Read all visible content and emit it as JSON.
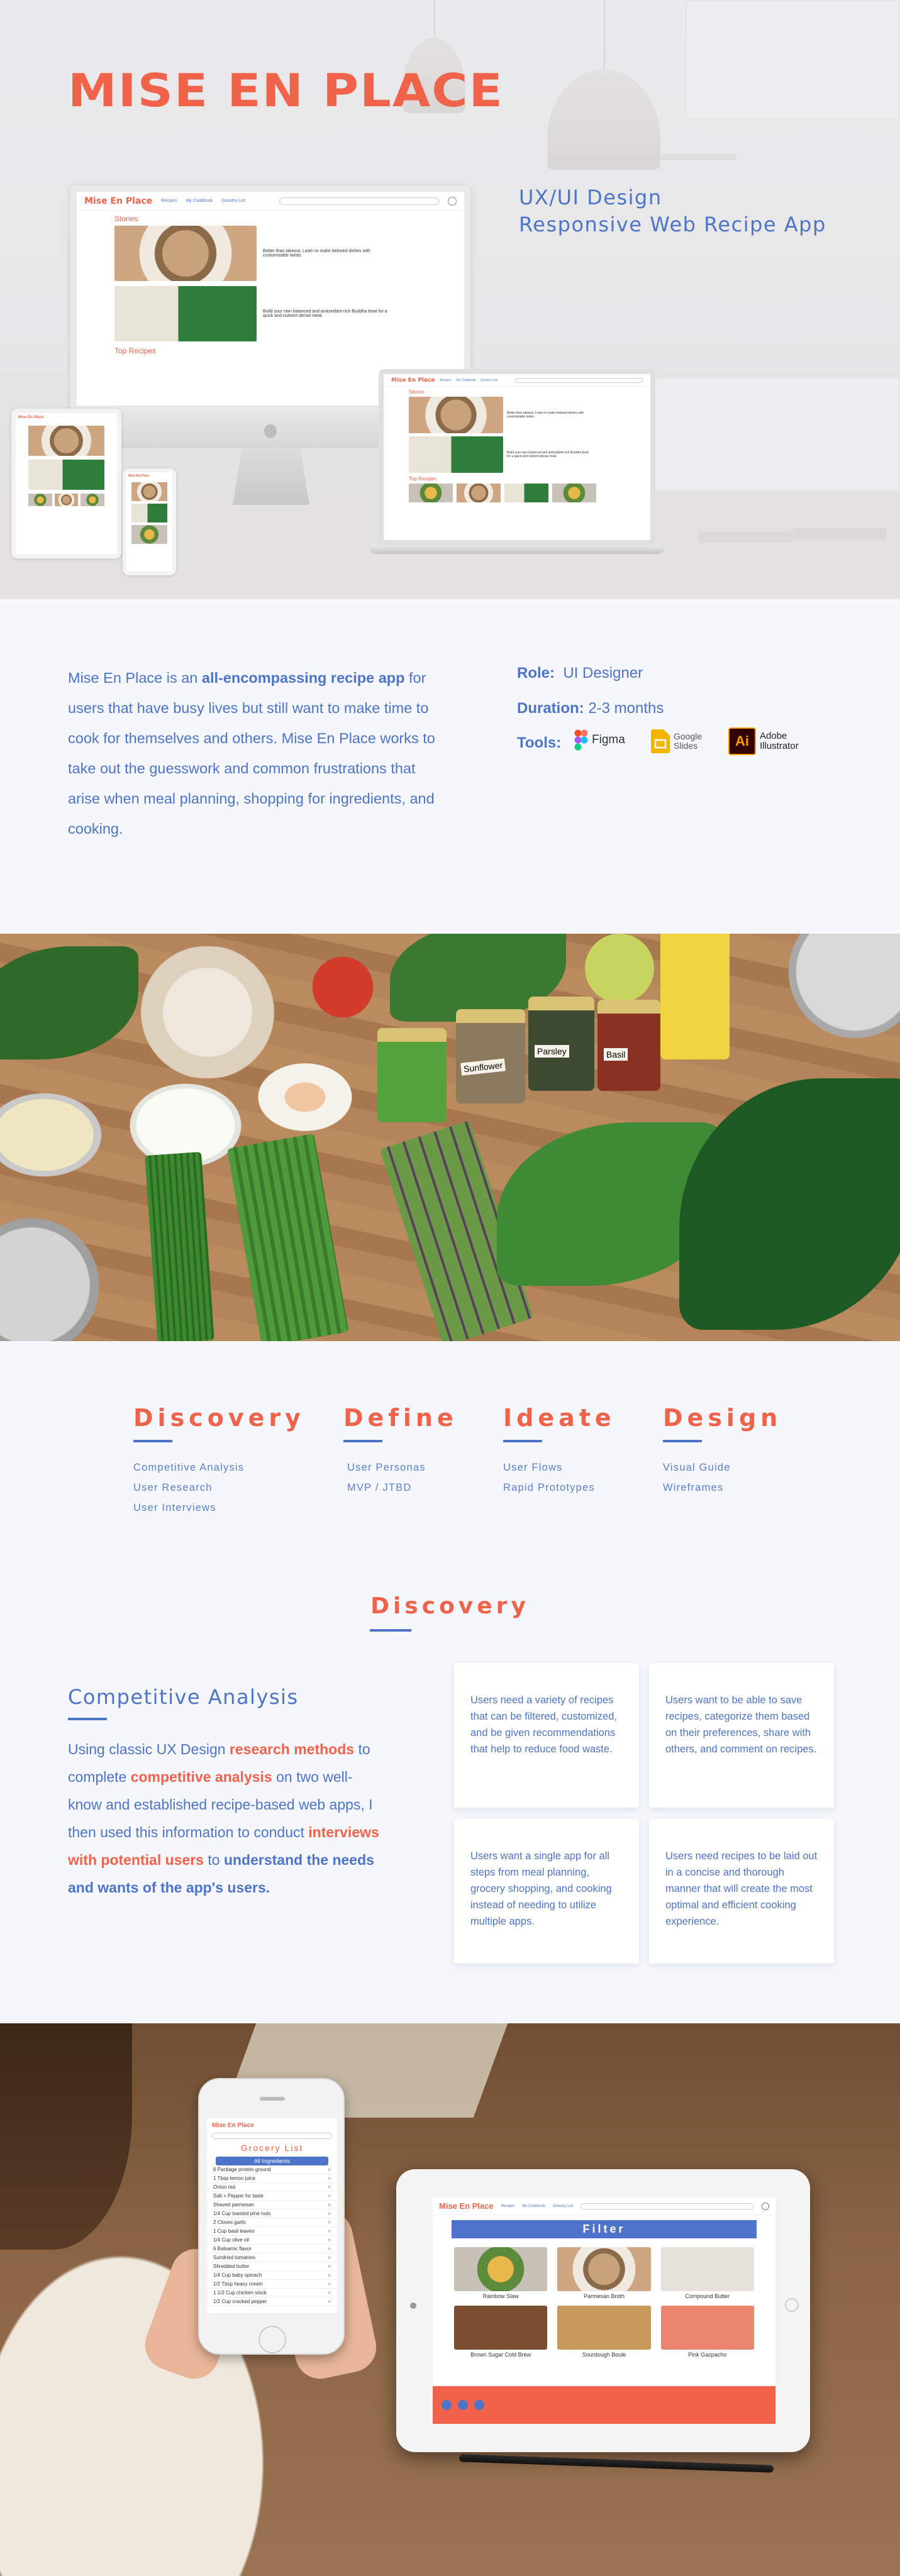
{
  "hero": {
    "brand": "Mise En Place",
    "subtitle_line1": "UX/UI Design",
    "subtitle_line2": "Responsive Web Recipe App"
  },
  "mockup": {
    "logo": "Mise En Place",
    "nav": [
      "Recipes",
      "My Cookbook",
      "Grocery List"
    ],
    "stories_heading": "Stories",
    "story1_text": "Better than takeout. Learn to make beloved dishes with customizable twists.",
    "story2_text": "Build your own balanced and antioxidant-rich Buddha bowl for a quick and nutrient dense meal.",
    "top_recipes": "Top Recipes"
  },
  "intro": {
    "p_part1": "Mise En Place is an ",
    "p_bold": "all-encompassing recipe app",
    "p_part2": " for users that have busy lives but still want to make time to cook for themselves and others. Mise En Place works to take out the guesswork and common frustrations that arise when meal planning, shopping for ingredients, and cooking.",
    "role_label": "Role:",
    "role_value": "UI Designer",
    "duration_label": "Duration:",
    "duration_value": "2-3 months",
    "tools_label": "Tools:",
    "tools": [
      "Figma",
      "Google Slides",
      "Adobe Illustrator"
    ]
  },
  "ingredients_photo": {
    "jar_labels": [
      "Sunflower",
      "Parsley",
      "Basil"
    ]
  },
  "phases": [
    {
      "title": "Discovery",
      "items": [
        "Competitive Analysis",
        "User Research",
        "User Interviews"
      ]
    },
    {
      "title": "Define",
      "items": [
        "User Personas",
        "MVP / JTBD"
      ]
    },
    {
      "title": "Ideate",
      "items": [
        "User Flows",
        "Rapid Prototypes"
      ]
    },
    {
      "title": "Design",
      "items": [
        "Visual Guide",
        "Wireframes"
      ]
    }
  ],
  "discovery": {
    "title": "Discovery",
    "ca_title": "Competitive  Analysis",
    "ca_p1": "Using classic UX Design ",
    "ca_hl1": "research methods",
    "ca_p2": " to complete ",
    "ca_hl2": "competitive analysis",
    "ca_p3": " on two well-know and established recipe-based web apps, I then used this information to conduct ",
    "ca_hl3": "interviews with potential users",
    "ca_p4": " to ",
    "ca_bold": "understand the needs and wants of the app's users.",
    "cards": [
      "Users need a variety of recipes that can be filtered, customized, and be given recommendations that help to reduce food waste.",
      "Users want to be able to save recipes, categorize them based on their preferences, share with others, and comment on recipes.",
      "Users want a single app for all steps from meal planning, grocery shopping, and cooking instead of needing to utilize multiple apps.",
      "Users need recipes to be laid out in a concise and thorough manner that will create the most optimal and efficient cooking experience."
    ]
  },
  "devices": {
    "grocery_title": "Grocery List",
    "all_ingredients": "All Ingredients",
    "grocery_items": [
      "6 Package protein ground",
      "1 Tbsp lemon juice",
      "Onion red",
      "Salt + Pepper for taste",
      "Shaved parmesan",
      "1/4 Cup toasted pine nuts",
      "2 Cloves garlic",
      "1 Cup basil leaves",
      "1/4 Cup olive oil",
      "6 Balsamic flavor",
      "Sundried tomatoes",
      "Shredded butter",
      "1/4 Cup baby spinach",
      "1/2 Tbsp heavy cream",
      "1 1/2 Cup chicken stock",
      "1/2 Cup cracked pepper"
    ],
    "filter_label": "Filter",
    "recipes": [
      "Rainbow Slaw",
      "Parmesan Broth",
      "Compound Butter",
      "Brown Sugar Cold Brew",
      "Sourdough Boule",
      "Pink Gazpacho"
    ]
  },
  "colors": {
    "accent": "#f0624a",
    "primary": "#4d74c9",
    "background": "#f5f7fc"
  }
}
